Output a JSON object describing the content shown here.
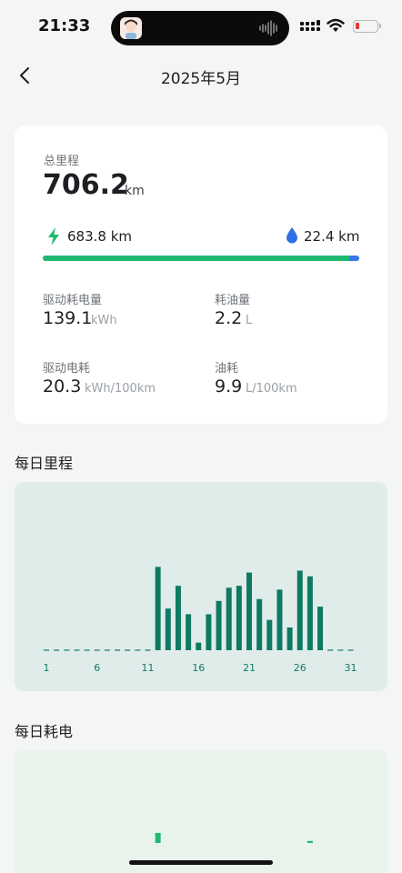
{
  "status_bar": {
    "time": "21:33"
  },
  "header": {
    "title": "2025年5月"
  },
  "summary": {
    "total_label": "总里程",
    "total_value": "706.2",
    "total_unit": "km",
    "electric": "683.8 km",
    "fuel": "22.4 km",
    "electric_share": 0.968,
    "stats": [
      {
        "label": "驱动耗电量",
        "value": "139.1",
        "unit": "kWh"
      },
      {
        "label": "耗油量",
        "value": "2.2",
        "unit": "L"
      },
      {
        "label": "驱动电耗",
        "value": "20.3",
        "unit": "kWh/100km"
      },
      {
        "label": "油耗",
        "value": "9.9",
        "unit": "L/100km"
      }
    ]
  },
  "daily_mileage": {
    "title": "每日里程"
  },
  "daily_energy": {
    "title": "每日耗电"
  },
  "colors": {
    "green": "#20b971",
    "blue": "#3b78e7",
    "bar": "#0f7a63",
    "chart_bg": "#e0ecea",
    "chart2_bg": "#e8f3ec"
  },
  "chart_data": [
    {
      "type": "bar",
      "categories": [
        "1",
        "2",
        "3",
        "4",
        "5",
        "6",
        "7",
        "8",
        "9",
        "10",
        "11",
        "12",
        "13",
        "14",
        "15",
        "16",
        "17",
        "18",
        "19",
        "20",
        "21",
        "22",
        "23",
        "24",
        "25",
        "26",
        "27",
        "28",
        "29",
        "30",
        "31"
      ],
      "tick_labels": [
        "1",
        "6",
        "11",
        "16",
        "21",
        "26",
        "31"
      ],
      "values": [
        0,
        0,
        0,
        0,
        0,
        0,
        0,
        0,
        0,
        0,
        0,
        44,
        22,
        34,
        19,
        4,
        19,
        26,
        33,
        34,
        41,
        27,
        16,
        32,
        12,
        42,
        39,
        23,
        0,
        0,
        0
      ],
      "ylim": [
        0,
        48
      ],
      "grid": false
    },
    {
      "type": "bar",
      "categories": [
        "12",
        "27"
      ],
      "values": [
        5,
        1
      ],
      "note": "partially visible"
    }
  ]
}
